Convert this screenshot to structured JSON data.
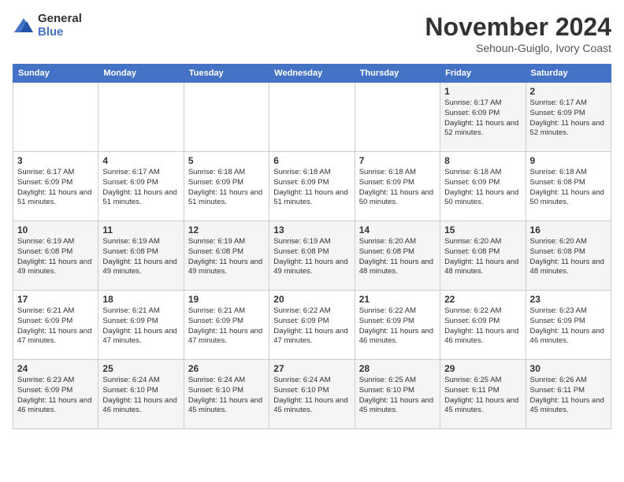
{
  "logo": {
    "general": "General",
    "blue": "Blue"
  },
  "title": "November 2024",
  "subtitle": "Sehoun-Guiglo, Ivory Coast",
  "weekdays": [
    "Sunday",
    "Monday",
    "Tuesday",
    "Wednesday",
    "Thursday",
    "Friday",
    "Saturday"
  ],
  "weeks": [
    [
      {
        "day": "",
        "info": ""
      },
      {
        "day": "",
        "info": ""
      },
      {
        "day": "",
        "info": ""
      },
      {
        "day": "",
        "info": ""
      },
      {
        "day": "",
        "info": ""
      },
      {
        "day": "1",
        "info": "Sunrise: 6:17 AM\nSunset: 6:09 PM\nDaylight: 11 hours and 52 minutes."
      },
      {
        "day": "2",
        "info": "Sunrise: 6:17 AM\nSunset: 6:09 PM\nDaylight: 11 hours and 52 minutes."
      }
    ],
    [
      {
        "day": "3",
        "info": "Sunrise: 6:17 AM\nSunset: 6:09 PM\nDaylight: 11 hours and 51 minutes."
      },
      {
        "day": "4",
        "info": "Sunrise: 6:17 AM\nSunset: 6:09 PM\nDaylight: 11 hours and 51 minutes."
      },
      {
        "day": "5",
        "info": "Sunrise: 6:18 AM\nSunset: 6:09 PM\nDaylight: 11 hours and 51 minutes."
      },
      {
        "day": "6",
        "info": "Sunrise: 6:18 AM\nSunset: 6:09 PM\nDaylight: 11 hours and 51 minutes."
      },
      {
        "day": "7",
        "info": "Sunrise: 6:18 AM\nSunset: 6:09 PM\nDaylight: 11 hours and 50 minutes."
      },
      {
        "day": "8",
        "info": "Sunrise: 6:18 AM\nSunset: 6:09 PM\nDaylight: 11 hours and 50 minutes."
      },
      {
        "day": "9",
        "info": "Sunrise: 6:18 AM\nSunset: 6:08 PM\nDaylight: 11 hours and 50 minutes."
      }
    ],
    [
      {
        "day": "10",
        "info": "Sunrise: 6:19 AM\nSunset: 6:08 PM\nDaylight: 11 hours and 49 minutes."
      },
      {
        "day": "11",
        "info": "Sunrise: 6:19 AM\nSunset: 6:08 PM\nDaylight: 11 hours and 49 minutes."
      },
      {
        "day": "12",
        "info": "Sunrise: 6:19 AM\nSunset: 6:08 PM\nDaylight: 11 hours and 49 minutes."
      },
      {
        "day": "13",
        "info": "Sunrise: 6:19 AM\nSunset: 6:08 PM\nDaylight: 11 hours and 49 minutes."
      },
      {
        "day": "14",
        "info": "Sunrise: 6:20 AM\nSunset: 6:08 PM\nDaylight: 11 hours and 48 minutes."
      },
      {
        "day": "15",
        "info": "Sunrise: 6:20 AM\nSunset: 6:08 PM\nDaylight: 11 hours and 48 minutes."
      },
      {
        "day": "16",
        "info": "Sunrise: 6:20 AM\nSunset: 6:08 PM\nDaylight: 11 hours and 48 minutes."
      }
    ],
    [
      {
        "day": "17",
        "info": "Sunrise: 6:21 AM\nSunset: 6:09 PM\nDaylight: 11 hours and 47 minutes."
      },
      {
        "day": "18",
        "info": "Sunrise: 6:21 AM\nSunset: 6:09 PM\nDaylight: 11 hours and 47 minutes."
      },
      {
        "day": "19",
        "info": "Sunrise: 6:21 AM\nSunset: 6:09 PM\nDaylight: 11 hours and 47 minutes."
      },
      {
        "day": "20",
        "info": "Sunrise: 6:22 AM\nSunset: 6:09 PM\nDaylight: 11 hours and 47 minutes."
      },
      {
        "day": "21",
        "info": "Sunrise: 6:22 AM\nSunset: 6:09 PM\nDaylight: 11 hours and 46 minutes."
      },
      {
        "day": "22",
        "info": "Sunrise: 6:22 AM\nSunset: 6:09 PM\nDaylight: 11 hours and 46 minutes."
      },
      {
        "day": "23",
        "info": "Sunrise: 6:23 AM\nSunset: 6:09 PM\nDaylight: 11 hours and 46 minutes."
      }
    ],
    [
      {
        "day": "24",
        "info": "Sunrise: 6:23 AM\nSunset: 6:09 PM\nDaylight: 11 hours and 46 minutes."
      },
      {
        "day": "25",
        "info": "Sunrise: 6:24 AM\nSunset: 6:10 PM\nDaylight: 11 hours and 46 minutes."
      },
      {
        "day": "26",
        "info": "Sunrise: 6:24 AM\nSunset: 6:10 PM\nDaylight: 11 hours and 45 minutes."
      },
      {
        "day": "27",
        "info": "Sunrise: 6:24 AM\nSunset: 6:10 PM\nDaylight: 11 hours and 45 minutes."
      },
      {
        "day": "28",
        "info": "Sunrise: 6:25 AM\nSunset: 6:10 PM\nDaylight: 11 hours and 45 minutes."
      },
      {
        "day": "29",
        "info": "Sunrise: 6:25 AM\nSunset: 6:11 PM\nDaylight: 11 hours and 45 minutes."
      },
      {
        "day": "30",
        "info": "Sunrise: 6:26 AM\nSunset: 6:11 PM\nDaylight: 11 hours and 45 minutes."
      }
    ]
  ]
}
